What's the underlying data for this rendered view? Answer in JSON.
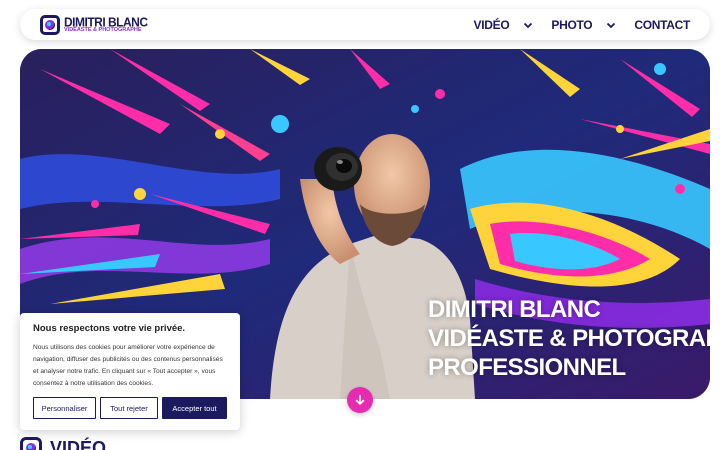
{
  "header": {
    "logo_title": "DIMITRI BLANC",
    "logo_subtitle": "VIDÉASTE & PHOTOGRAPHE",
    "nav": [
      {
        "label": "VIDÉO",
        "has_dropdown": true
      },
      {
        "label": "PHOTO",
        "has_dropdown": true
      },
      {
        "label": "CONTACT",
        "has_dropdown": false
      }
    ]
  },
  "hero": {
    "title_lines": [
      "DIMITRI BLANC",
      "VIDÉASTE & PHOTOGRAPHE",
      "PROFESSIONNEL"
    ],
    "scroll_icon": "arrow-down-icon"
  },
  "section": {
    "title": "VIDÉO"
  },
  "cookie": {
    "title": "Nous respectons votre vie privée.",
    "text": "Nous utilisons des cookies pour améliorer votre expérience de navigation, diffuser des publicités ou des contenus personnalisés et analyser notre trafic. En cliquant sur « Tout accepter », vous consentez à notre utilisation des cookies.",
    "btn_customize": "Personnaliser",
    "btn_reject": "Tout rejeter",
    "btn_accept": "Accepter tout"
  },
  "colors": {
    "brand_navy": "#1b1a5e",
    "accent_magenta": "#e62bb0",
    "accent_purple": "#8a2be2"
  }
}
